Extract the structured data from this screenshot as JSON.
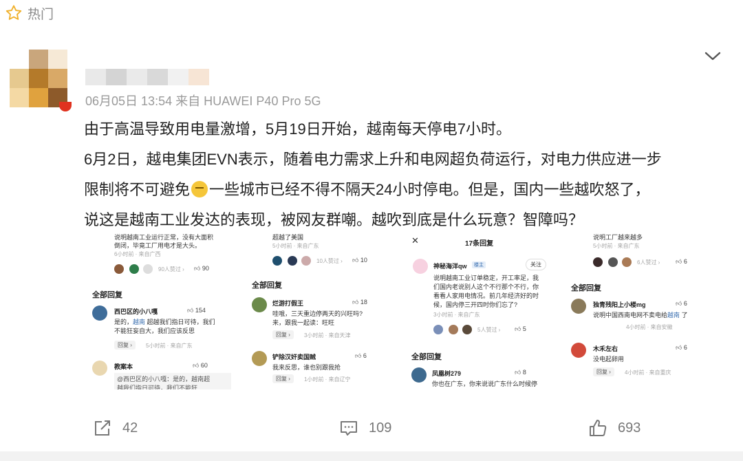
{
  "header": {
    "hot_label": "热门",
    "hot_icon": "star-outline-icon"
  },
  "post": {
    "meta": "06月05日 13:54  来自 HUAWEI P40 Pro 5G",
    "line1": "由于高温导致用电量激增，5月19日开始，越南每天停电7小时。",
    "line2": "6月2日，越电集团EVN表示，随着电力需求上升和电网超负荷运行，对电力供应进一步",
    "line3a": "限制将不可避免",
    "line3b": "一些城市已经不得不隔天24小时停电。但是，国内一些越吹怒了，",
    "line4": "说这是越南工业发达的表现，被网友群嘲。越吹到底是什么玩意？智障吗？"
  },
  "shot1": {
    "top_a": "说明越南工业运行正常，没有大面积",
    "top_b": "倒闭，毕竟工厂用电才是大头。",
    "top_time": "6小时前 · 来自广西",
    "likers": "90人赞过 ›",
    "likes": "90",
    "section": "全部回复",
    "c1_name": "西巴区的小八嘎",
    "c1_likes": "154",
    "c1_text_a": "是的，",
    "c1_link": "越南",
    "c1_text_b": " 超越我们指日可待，我们",
    "c1_text_c": "不能狂妄自大，我们应该反思",
    "c1_reply": "回复 ›",
    "c1_time": "5小时前 · 来自广东",
    "c2_name": "教案本",
    "c2_likes": "60",
    "c2_quote_a": "@西巴区的小八嘎：是的，越南超",
    "c2_quote_b": "越我们指日可待，我们不能狂"
  },
  "shot2": {
    "top": "超越了美国",
    "top_time": "5小时前 · 来自广东",
    "likers": "10人赞过 ›",
    "likes": "10",
    "section": "全部回复",
    "c1_name": "烂游打假王",
    "c1_likes": "18",
    "c1_text_a": "哇哦，三天重边停两天的兴旺吗?",
    "c1_text_b": "来，跟我一起读：旺旺",
    "c1_reply": "回复 ›",
    "c1_time": "3小时前 · 来自天津",
    "c2_name": "铲除汉奸卖国贼",
    "c2_likes": "6",
    "c2_text": "我来反思，谁也别跟我抢",
    "c2_reply": "回复 ›",
    "c2_time": "1小时前 · 来自辽宁"
  },
  "shot3": {
    "close": "✕",
    "title": "17条回复",
    "name": "神秘海洋qw",
    "badge": "楼主",
    "follow": "关注",
    "text_a": "说明越南工业订单稳定，开工率足，我",
    "text_b": "们国内老说别人这个不行那个不行，你",
    "text_c": "看看人家用电情况。前几年经济好的时",
    "text_d": "候，国内停三开四时你们忘了?",
    "time": "3小时前 · 来自广东",
    "likers": "5人赞过 ›",
    "likes": "5",
    "section": "全部回复",
    "c1_name": "凤凰树279",
    "c1_likes": "8",
    "c1_text": "你也在广东，你来说说广东什么时候停"
  },
  "shot4": {
    "top_a": "说明工厂越来越多",
    "top_time": "5小时前 · 来自广东",
    "likers": "6人赞过 ›",
    "likes": "6",
    "section": "全部回复",
    "c1_name": "独青残阳上小楼mg",
    "c1_likes": "6",
    "c1_text_a": "说明中国西南电网不卖电给",
    "c1_link": "越南",
    "c1_text_b": " 了",
    "c1_time": "4小时前 · 来自安徽",
    "c2_name": "木禾左右",
    "c2_likes": "6",
    "c2_text": "没电起卵用",
    "c2_reply": "回复 ›",
    "c2_time": "4小时前 · 来自重庆"
  },
  "actions": {
    "share_count": "42",
    "comment_count": "109",
    "like_count": "693"
  }
}
